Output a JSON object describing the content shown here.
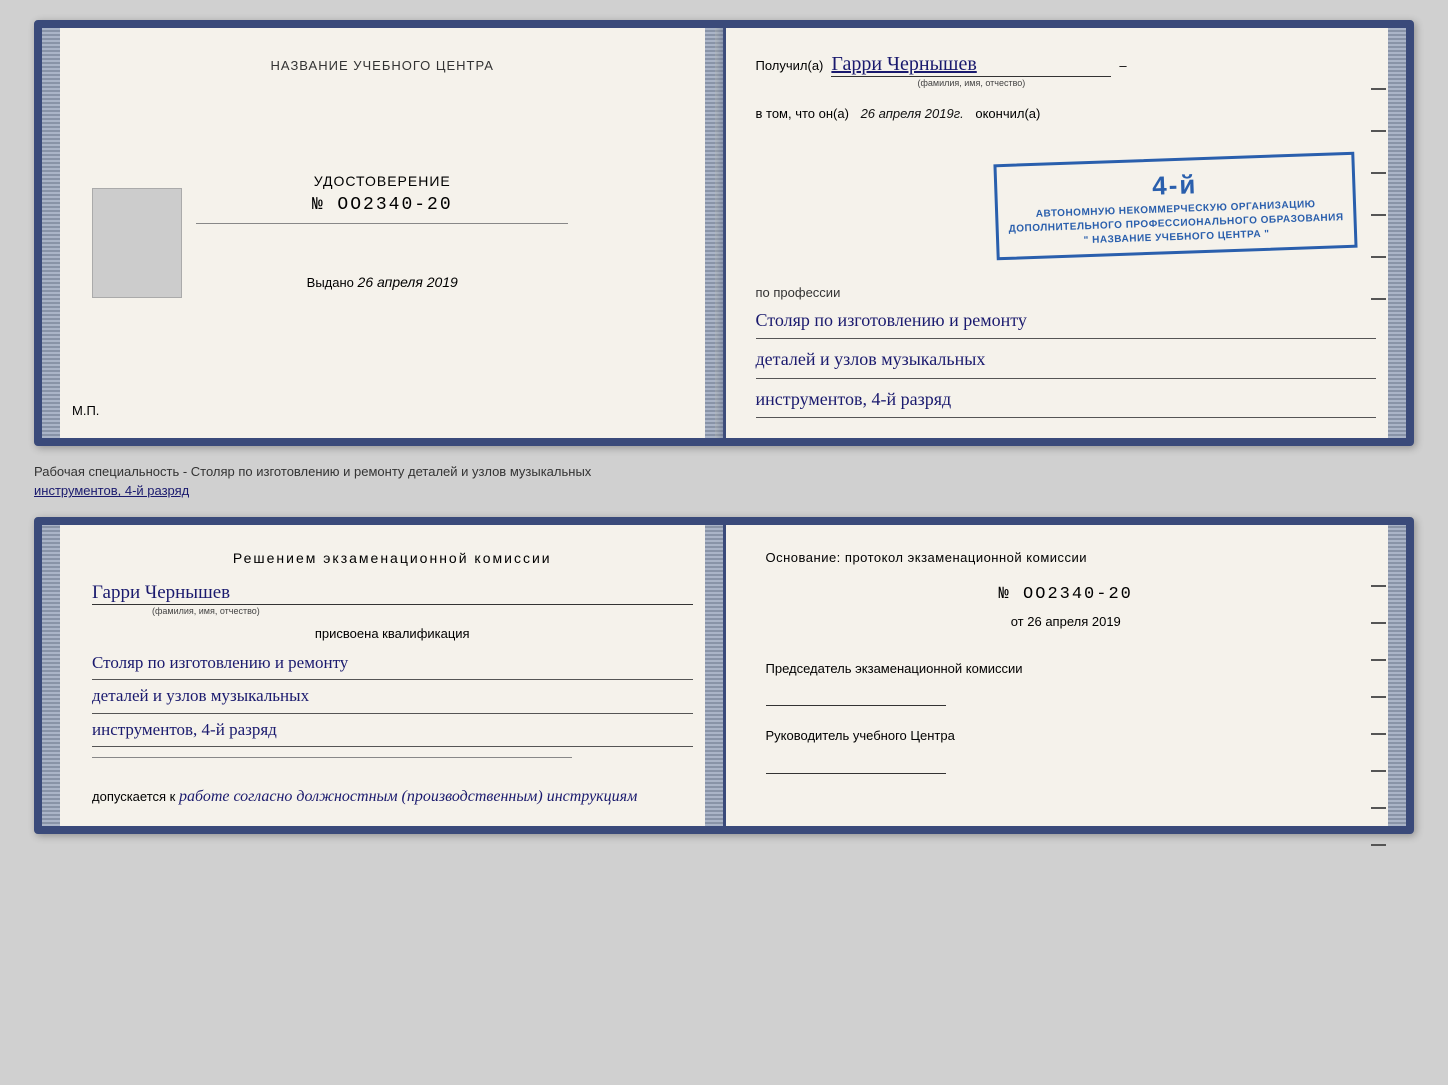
{
  "top_spread": {
    "left": {
      "center_title": "НАЗВАНИЕ УЧЕБНОГО ЦЕНТРА",
      "udostoverenie_label": "УДОСТОВЕРЕНИЕ",
      "cert_number": "№ OO2340-20",
      "vydano_label": "Выдано",
      "vydano_date": "26 апреля 2019",
      "mp_label": "М.П."
    },
    "right": {
      "poluchil_label": "Получил(а)",
      "recipient_name": "Гарри Чернышев",
      "recipient_hint": "(фамилия, имя, отчество)",
      "vtom_label": "в том, что он(а)",
      "completion_date": "26 апреля 2019г.",
      "okonchill_label": "окончил(а)",
      "stamp_number": "4-й",
      "stamp_line1": "АВТОНОМНУЮ НЕКОММЕРЧЕСКУЮ ОРГАНИЗАЦИЮ",
      "stamp_line2": "ДОПОЛНИТЕЛЬНОГО ПРОФЕССИОНАЛЬНОГО ОБРАЗОВАНИЯ",
      "stamp_line3": "\" НАЗВАНИЕ УЧЕБНОГО ЦЕНТРА \"",
      "po_professii_label": "по профессии",
      "profession_line1": "Столяр по изготовлению и ремонту",
      "profession_line2": "деталей и узлов музыкальных",
      "profession_line3": "инструментов, 4-й разряд"
    }
  },
  "caption": {
    "text_prefix": "Рабочая специальность - Столяр по изготовлению и ремонту деталей и узлов музыкальных",
    "text_underline": "инструментов, 4-й разряд"
  },
  "bottom_spread": {
    "left": {
      "resheniem_title": "Решением  экзаменационной  комиссии",
      "recipient_name": "Гарри Чернышев",
      "recipient_hint": "(фамилия, имя, отчество)",
      "prisvoena_label": "присвоена квалификация",
      "profession_line1": "Столяр по изготовлению и ремонту",
      "profession_line2": "деталей и узлов музыкальных",
      "profession_line3": "инструментов, 4-й разряд",
      "dopuskaetsya_label": "допускается к",
      "dopusk_text": "работе согласно должностным (производственным) инструкциям"
    },
    "right": {
      "osnovanie_label": "Основание: протокол экзаменационной  комиссии",
      "protocol_number": "№  OO2340-20",
      "ot_label": "от",
      "ot_date": "26 апреля 2019",
      "predsedatel_label": "Председатель экзаменационной комиссии",
      "rukovoditel_label": "Руководитель учебного Центра"
    }
  },
  "colors": {
    "accent": "#3a4a7a",
    "handwriting": "#1a1a6e",
    "stamp": "#2a5fad"
  }
}
